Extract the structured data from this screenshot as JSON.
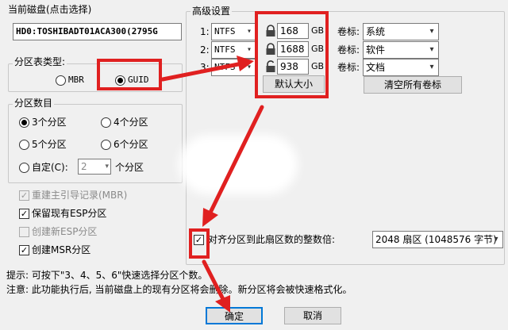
{
  "current_disk": {
    "title": "当前磁盘(点击选择)",
    "value": "HD0:TOSHIBADT01ACA300(2795G"
  },
  "partition_table": {
    "title": "分区表类型:",
    "options": [
      "MBR",
      "GUID"
    ],
    "selected": "GUID"
  },
  "partition_count": {
    "title": "分区数目",
    "options": [
      "3个分区",
      "4个分区",
      "5个分区",
      "6个分区"
    ],
    "selected": "3个分区",
    "custom_label": "自定(C):",
    "custom_value": "2",
    "custom_suffix": "个分区"
  },
  "options": {
    "rebuild_mbr": "重建主引导记录(MBR)",
    "keep_esp": "保留现有ESP分区",
    "create_esp": "创建新ESP分区",
    "create_msr": "创建MSR分区"
  },
  "advanced": {
    "title": "高级设置",
    "rows": [
      {
        "index": "1:",
        "fs": "NTFS",
        "size": "168",
        "unit": "GB",
        "label_caption": "卷标:",
        "label": "系统"
      },
      {
        "index": "2:",
        "fs": "NTFS",
        "size": "1688",
        "unit": "GB",
        "label_caption": "卷标:",
        "label": "软件"
      },
      {
        "index": "3:",
        "fs": "NTFS",
        "size": "938",
        "unit": "GB",
        "label_caption": "卷标:",
        "label": "文档"
      }
    ],
    "default_size_button": "默认大小",
    "clear_labels_button": "清空所有卷标"
  },
  "align": {
    "label": "对齐分区到此扇区数的整数倍:",
    "value": "2048 扇区 (1048576 字节)"
  },
  "tips": {
    "hint": "提示: 可按下\"3、4、5、6\"快速选择分区个数。",
    "warning": "注意: 此功能执行后, 当前磁盘上的现有分区将会删除。新分区将会被快速格式化。"
  },
  "buttons": {
    "ok": "确定",
    "cancel": "取消"
  },
  "annotation_color": "#e02020"
}
